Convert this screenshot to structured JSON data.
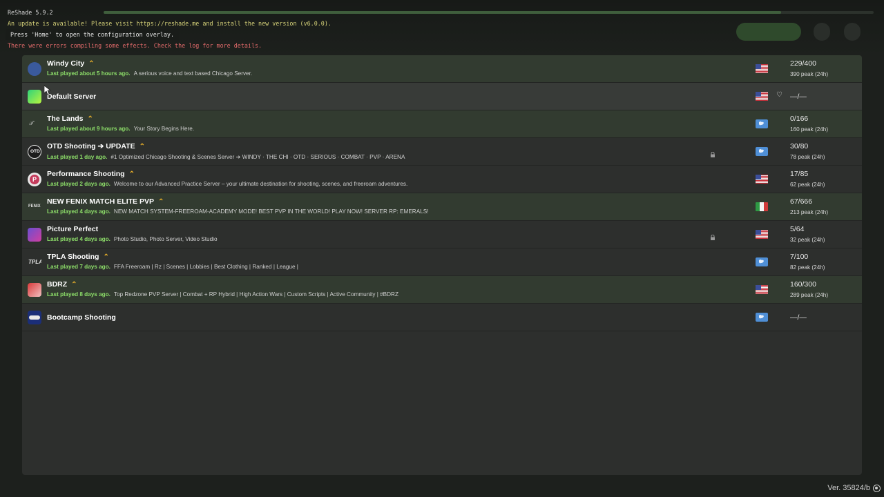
{
  "reshade": {
    "version": "ReShade 5.9.2",
    "update": "An update is available! Please visit https://reshade.me and install the new version (v6.0.0).",
    "hint": "Press 'Home' to open the configuration overlay.",
    "error": "There were errors compiling some effects. Check the log for more details."
  },
  "servers": [
    {
      "name": "Windy City",
      "boosted": true,
      "last": "Last played about 5 hours ago.",
      "desc": "A serious voice and text based Chicago Server.",
      "players": "229/400",
      "peak": "390 peak (24h)",
      "flag": "us",
      "locked": false,
      "favorite": false,
      "highlight": true,
      "icon": "windy-city-logo-icon"
    },
    {
      "name": "Default Server",
      "boosted": false,
      "last": "",
      "desc": "",
      "players": "—/—",
      "peak": "",
      "flag": "us",
      "locked": false,
      "favorite": true,
      "highlight": false,
      "selected": true,
      "icon": "default-server-icon"
    },
    {
      "name": "The Lands",
      "boosted": true,
      "last": "Last played about 9 hours ago.",
      "desc": "Your Story Begins Here.",
      "players": "0/166",
      "peak": "160 peak (24h)",
      "flag": "globe",
      "locked": false,
      "favorite": false,
      "highlight": true,
      "icon": "the-lands-logo-icon"
    },
    {
      "name": "OTD Shooting ➔ UPDATE",
      "boosted": true,
      "last": "Last played 1 day ago.",
      "desc": "#1 Optimized Chicago Shooting & Scenes Server ➔ WINDY · THE CHI · OTD · SERIOUS · COMBAT · PVP · ARENA",
      "players": "30/80",
      "peak": "78 peak (24h)",
      "flag": "globe",
      "locked": true,
      "favorite": false,
      "highlight": false,
      "icon": "otd-logo-icon"
    },
    {
      "name": "Performance Shooting",
      "boosted": true,
      "last": "Last played 2 days ago.",
      "desc": "Welcome to our Advanced Practice Server – your ultimate destination for shooting, scenes, and freeroam adventures.",
      "players": "17/85",
      "peak": "62 peak (24h)",
      "flag": "us",
      "locked": false,
      "favorite": false,
      "highlight": false,
      "icon": "performance-logo-icon"
    },
    {
      "name": "NEW FENIX MATCH ELITE PVP",
      "boosted": true,
      "last": "Last played 4 days ago.",
      "desc": "NEW MATCH SYSTEM-FREEROAM-ACADEMY MODE! BEST PVP IN THE WORLD! PLAY NOW! SERVER RP: EMERALS!",
      "players": "67/666",
      "peak": "213 peak (24h)",
      "flag": "it",
      "locked": false,
      "favorite": false,
      "highlight": true,
      "icon": "fenix-logo-icon"
    },
    {
      "name": "Picture Perfect",
      "boosted": false,
      "last": "Last played 4 days ago.",
      "desc": "Photo Studio, Photo Server, Video Studio",
      "players": "5/64",
      "peak": "32 peak (24h)",
      "flag": "us",
      "locked": true,
      "favorite": false,
      "highlight": false,
      "icon": "picture-perfect-logo-icon"
    },
    {
      "name": "TPLA Shooting",
      "boosted": true,
      "last": "Last played 7 days ago.",
      "desc": "FFA Freeroam | Rz | Scenes | Lobbies | Best Clothing | Ranked | League |",
      "players": "7/100",
      "peak": "82 peak (24h)",
      "flag": "globe",
      "locked": false,
      "favorite": false,
      "highlight": false,
      "icon": "tpla-logo-icon"
    },
    {
      "name": "BDRZ",
      "boosted": true,
      "last": "Last played 8 days ago.",
      "desc": "Top Redzone PVP Server | Combat + RP Hybrid | High Action Wars | Custom Scripts | Active Community | #BDRZ",
      "players": "160/300",
      "peak": "289 peak (24h)",
      "flag": "us",
      "locked": false,
      "favorite": false,
      "highlight": true,
      "icon": "bdrz-logo-icon"
    },
    {
      "name": "Bootcamp Shooting",
      "boosted": false,
      "last": "",
      "desc": "",
      "players": "—/—",
      "peak": "",
      "flag": "globe",
      "locked": false,
      "favorite": false,
      "highlight": false,
      "icon": "bootcamp-logo-icon"
    }
  ],
  "version": "Ver. 35824/b",
  "colors": {
    "accent_green": "#8ee06a",
    "boost": "#f0b429",
    "panel": "#2d2f2d",
    "highlight_row": "#323b30"
  }
}
